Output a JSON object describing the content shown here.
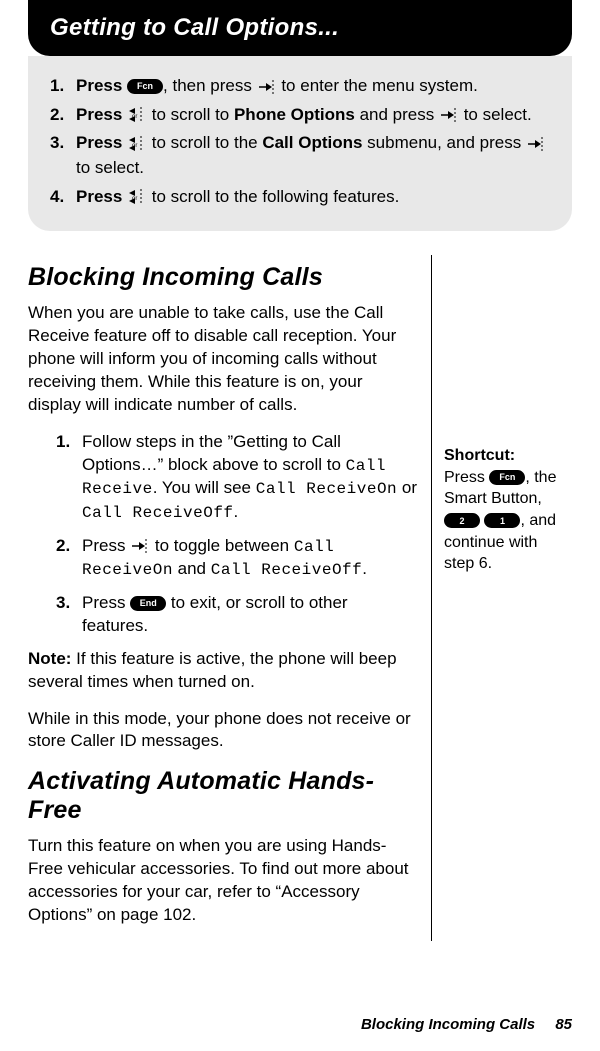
{
  "header": {
    "title": "Getting to Call Options..."
  },
  "steps": [
    {
      "num": "1.",
      "lead": "Press ",
      "key": "Fcn",
      "mid": ", then press ",
      "tail": " to enter the menu system."
    },
    {
      "num": "2.",
      "lead": "Press  ",
      "mid": " to scroll to ",
      "bold": "Phone Options",
      "mid2": " and press ",
      "tail": " to select."
    },
    {
      "num": "3.",
      "lead": "Press  ",
      "mid": " to scroll to the ",
      "bold": "Call Options",
      "mid2": " submenu, and press ",
      "tail": " to select."
    },
    {
      "num": "4.",
      "lead": "Press  ",
      "tail": " to scroll to the following features."
    }
  ],
  "section1": {
    "title": "Blocking Incoming Calls",
    "intro": "When you are unable to take calls, use the Call Receive feature off to disable call reception. Your phone will inform you of incoming calls without receiving them. While this feature is on, your display will indicate number of calls.",
    "sub": [
      {
        "num": "1.",
        "t1": "Follow steps in the ”Getting to Call Options…” block above to scroll to ",
        "lcd1": "Call Receive",
        "t2": ". You will see ",
        "lcd2": "Call ReceiveOn",
        "t3": " or ",
        "lcd3": "Call ReceiveOff",
        "t4": "."
      },
      {
        "num": "2.",
        "t1": "Press ",
        "t2": " to toggle between ",
        "lcd1": "Call ReceiveOn",
        "t3": " and ",
        "lcd2": "Call ReceiveOff",
        "t4": "."
      },
      {
        "num": "3.",
        "t1": "Press ",
        "key": "End",
        "t2": " to exit, or scroll to other features."
      }
    ],
    "note_label": "Note:",
    "note": " If this feature is active, the phone will beep several times when turned on.",
    "note2": "While in this mode, your phone does not receive or store Caller ID messages."
  },
  "section2": {
    "title": "Activating Automatic Hands-Free",
    "intro": "Turn this feature on when you are using Hands-Free vehicular accessories. To find out more about accessories for your car, refer to “Accessory Options” on page 102."
  },
  "shortcut": {
    "label": "Shortcut:",
    "t1": "Press ",
    "key1": "Fcn",
    "t2": ", the Smart Button, ",
    "key2": "2",
    "key3": "1",
    "t3": ", and continue with step 6."
  },
  "footer": {
    "title": "Blocking Incoming Calls",
    "page": "85"
  }
}
